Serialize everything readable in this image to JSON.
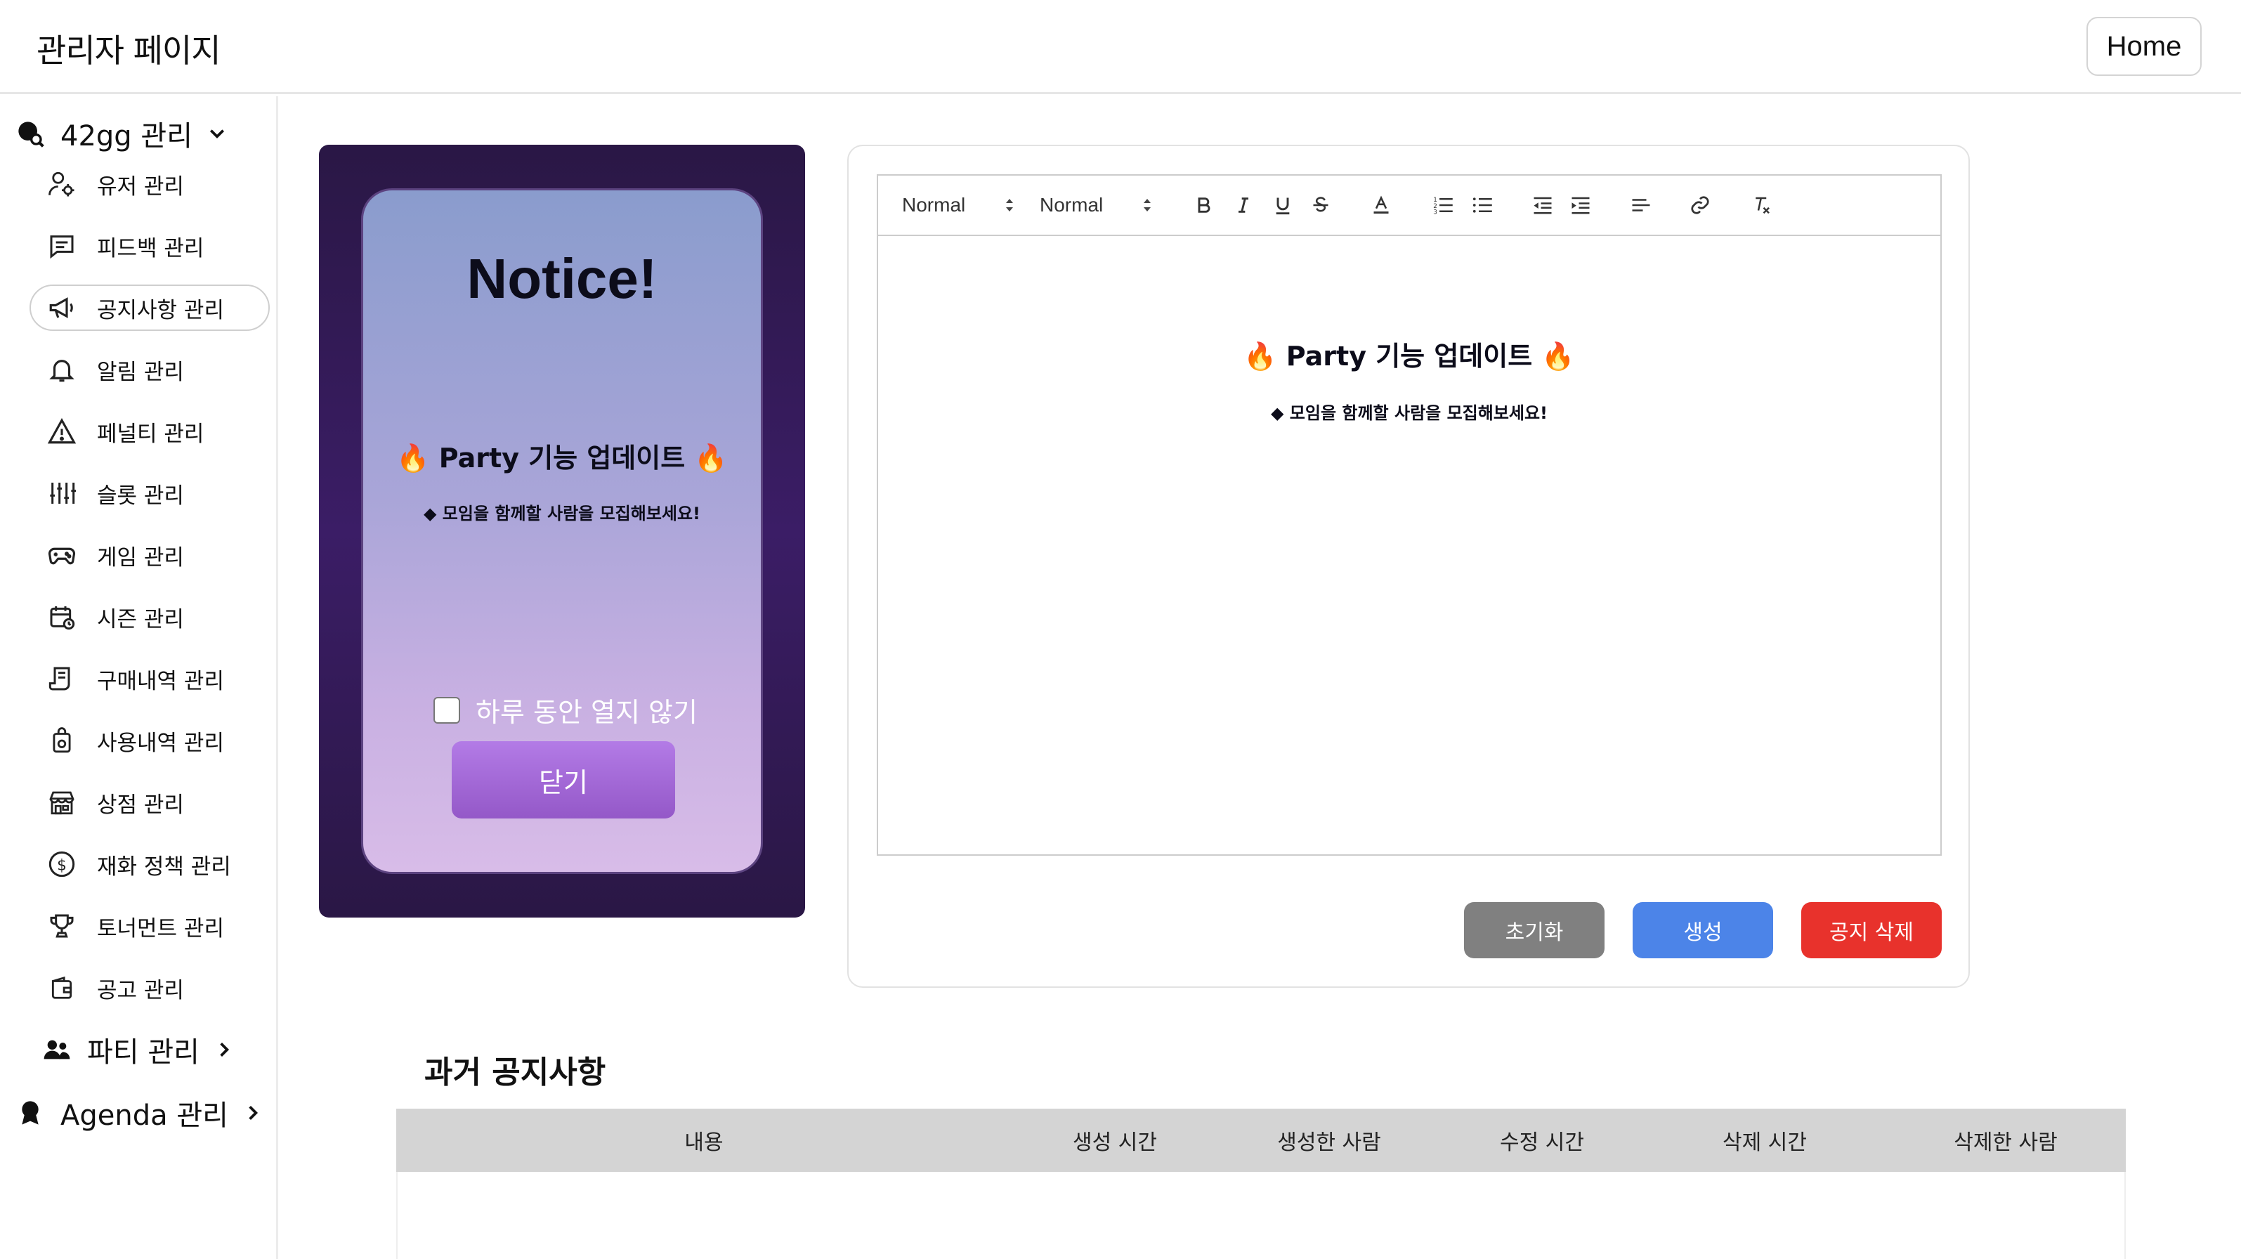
{
  "header": {
    "title": "관리자 페이지",
    "home_label": "Home"
  },
  "sidebar": {
    "group_42gg": "42gg 관리",
    "items": [
      {
        "label": "유저 관리",
        "icon": "user-gear-icon"
      },
      {
        "label": "피드백 관리",
        "icon": "message-icon"
      },
      {
        "label": "공지사항 관리",
        "icon": "megaphone-icon",
        "active": true
      },
      {
        "label": "알림 관리",
        "icon": "bell-icon"
      },
      {
        "label": "페널티 관리",
        "icon": "warning-icon"
      },
      {
        "label": "슬롯 관리",
        "icon": "sliders-icon"
      },
      {
        "label": "게임 관리",
        "icon": "gamepad-icon"
      },
      {
        "label": "시즌 관리",
        "icon": "calendar-icon"
      },
      {
        "label": "구매내역 관리",
        "icon": "receipt-icon"
      },
      {
        "label": "사용내역 관리",
        "icon": "bag-icon"
      },
      {
        "label": "상점 관리",
        "icon": "store-icon"
      },
      {
        "label": "재화 정책 관리",
        "icon": "dollar-icon"
      },
      {
        "label": "토너먼트 관리",
        "icon": "trophy-icon"
      },
      {
        "label": "공고 관리",
        "icon": "wallet-icon"
      }
    ],
    "group_party": "파티 관리",
    "group_agenda": "Agenda 관리"
  },
  "preview": {
    "title": "Notice!",
    "heading": "🔥 Party 기능 업데이트 🔥",
    "sub": "◆ 모임을 함께할 사람을 모집해보세요!",
    "dont_show_label": "하루 동안 열지 않기",
    "close_label": "닫기"
  },
  "editor": {
    "toolbar": {
      "header_select": "Normal",
      "size_select": "Normal"
    },
    "content_heading": "🔥 Party 기능 업데이트 🔥",
    "content_sub": "◆ 모임을 함께할 사람을 모집해보세요!"
  },
  "actions": {
    "reset_label": "초기화",
    "create_label": "생성",
    "delete_label": "공지 삭제"
  },
  "colors": {
    "reset": "#808080",
    "create": "#4c84e8",
    "delete": "#e8322c"
  },
  "past_notices": {
    "title": "과거 공지사항",
    "columns": [
      "내용",
      "생성 시간",
      "생성한 사람",
      "수정 시간",
      "삭제 시간",
      "삭제한 사람"
    ]
  }
}
